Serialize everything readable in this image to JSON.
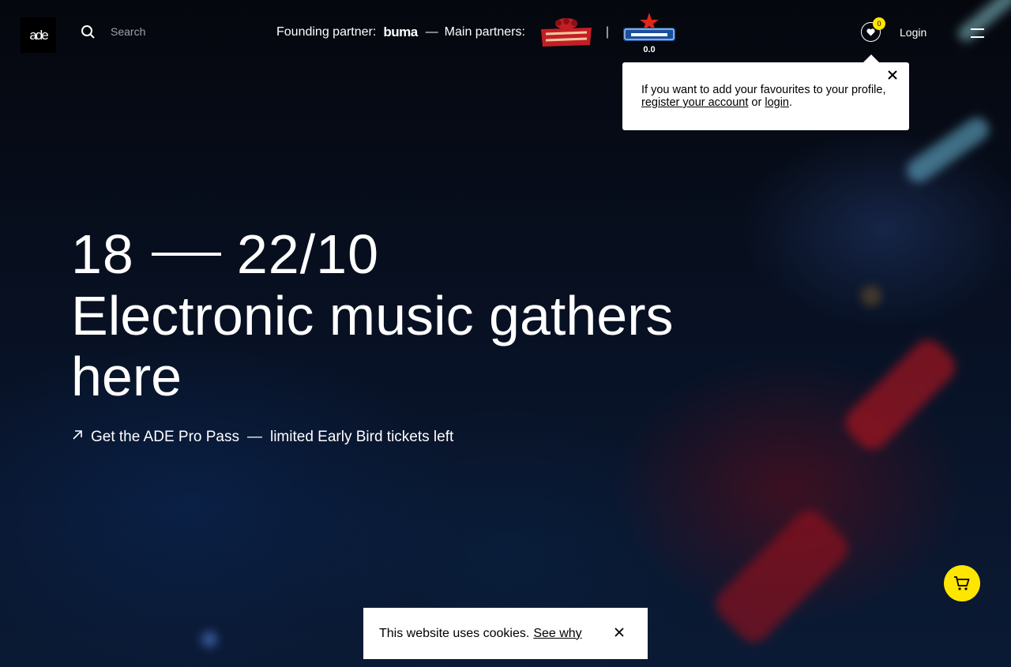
{
  "header": {
    "logo_text": "ade",
    "search_placeholder": "Search",
    "founding_label": "Founding partner:",
    "founding_partner": "buma",
    "dash": "—",
    "main_label": "Main partners:",
    "divider": "|",
    "partner_logos": [
      "desperados-logo",
      "heineken-logo"
    ],
    "favourites_count": "0",
    "login_label": "Login"
  },
  "tooltip": {
    "text_before": "If you want to add your favourites to your profile, ",
    "register_link": "register your account",
    "or_text": " or ",
    "login_link": "login",
    "period": "."
  },
  "hero": {
    "date_start": "18",
    "date_end": "22/10",
    "headline": "Electronic music gathers here",
    "cta_main": "Get the ADE Pro Pass",
    "cta_dash": "—",
    "cta_sub": "limited Early Bird tickets left"
  },
  "cookie": {
    "message": "This website uses cookies.",
    "link": "See why"
  },
  "colors": {
    "accent": "#ffe600",
    "background": "#060a14",
    "text": "#ffffff"
  }
}
